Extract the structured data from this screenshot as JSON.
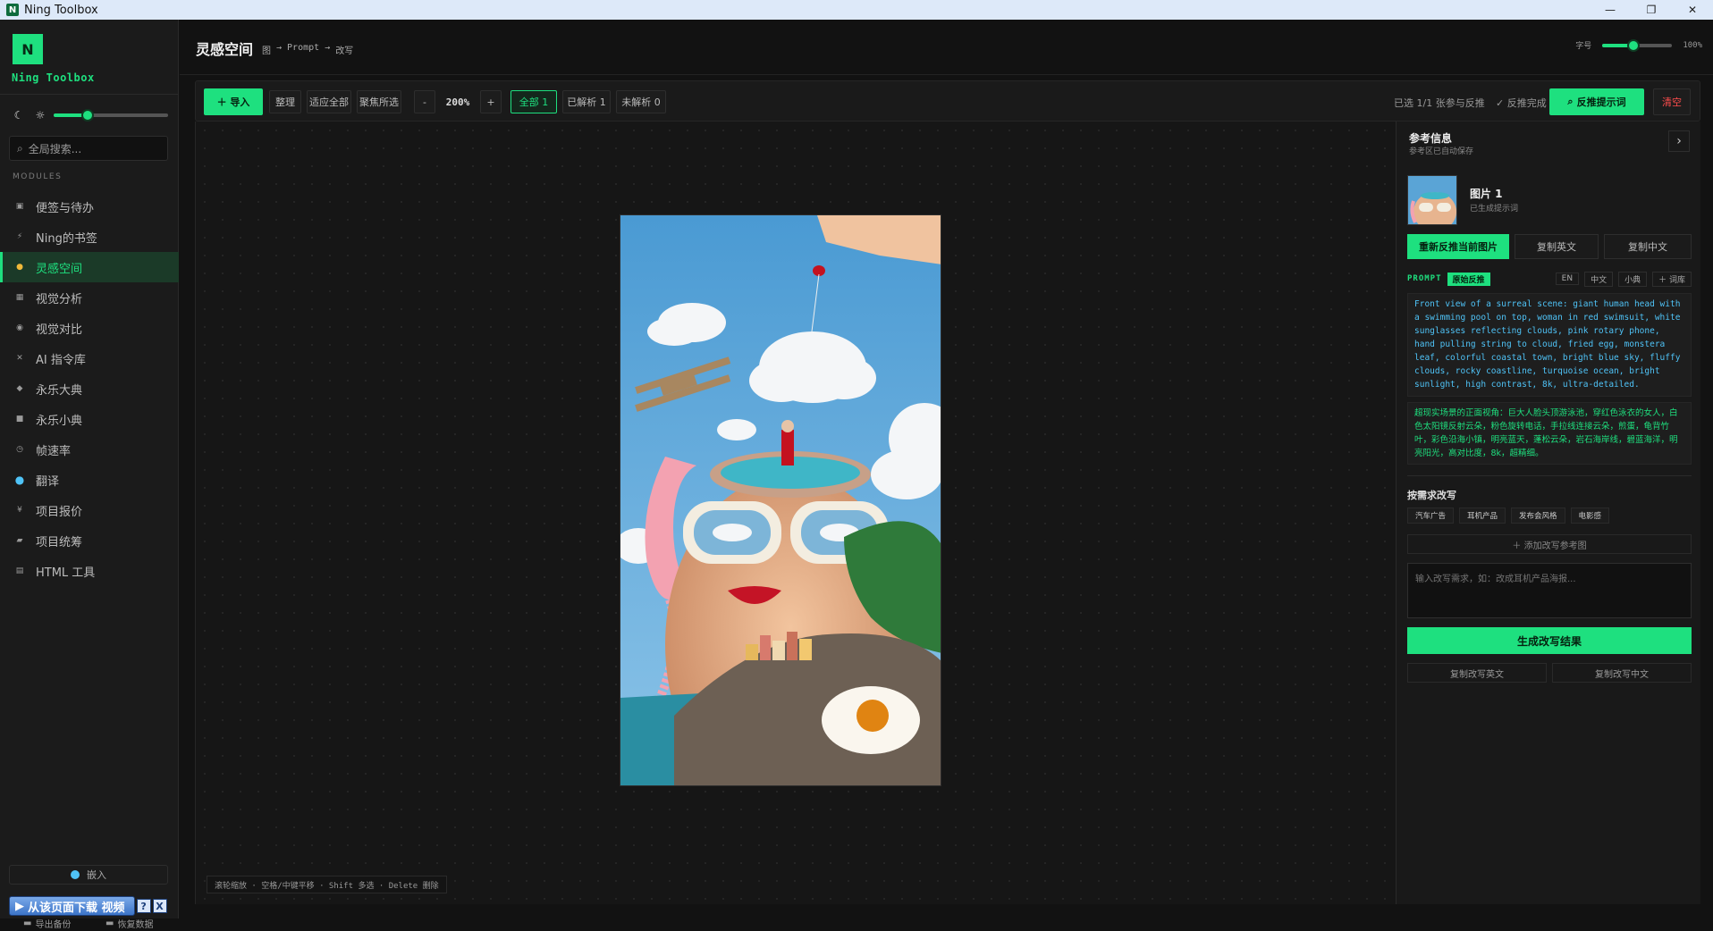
{
  "window": {
    "title": "Ning Toolbox",
    "controls": [
      "—",
      "❐",
      "✕"
    ]
  },
  "sidebar": {
    "logo_letter": "N",
    "brand": "Ning Toolbox",
    "search_placeholder": "全局搜索...",
    "modules_label": "MODULES",
    "brightness": 0.3,
    "items": [
      {
        "label": "便签与待办",
        "icon": "note-icon",
        "glyph": "▣"
      },
      {
        "label": "Ning的书签",
        "icon": "bolt-icon",
        "glyph": "⚡"
      },
      {
        "label": "灵感空间",
        "icon": "bulb-icon",
        "glyph": "●",
        "active": true
      },
      {
        "label": "视觉分析",
        "icon": "grid-icon",
        "glyph": "▦"
      },
      {
        "label": "视觉对比",
        "icon": "eye-icon",
        "glyph": "◉"
      },
      {
        "label": "AI 指令库",
        "icon": "cross-icon",
        "glyph": "✕"
      },
      {
        "label": "永乐大典",
        "icon": "diamond-icon",
        "glyph": "◆"
      },
      {
        "label": "永乐小典",
        "icon": "book-icon",
        "glyph": "■"
      },
      {
        "label": "帧速率",
        "icon": "timer-icon",
        "glyph": "◷"
      },
      {
        "label": "翻译",
        "icon": "globe-icon",
        "glyph": "●"
      },
      {
        "label": "项目报价",
        "icon": "yen-icon",
        "glyph": "¥"
      },
      {
        "label": "项目统筹",
        "icon": "folder-icon",
        "glyph": "▰"
      },
      {
        "label": "HTML 工具",
        "icon": "code-icon",
        "glyph": "▤"
      }
    ],
    "bottom_label": "嵌入",
    "export_label": "导出备份",
    "restore_label": "恢复数据",
    "download_label": "从该页面下载 视频",
    "download_help": "?",
    "download_close": "X"
  },
  "header": {
    "title": "灵感空间",
    "breadcrumb": [
      "图",
      "→",
      "Prompt",
      "→",
      "改写"
    ],
    "zoom_label": "字号",
    "zoom_value": "100%",
    "zoom_level": 0.45
  },
  "toolbar": {
    "import": "＋ 导入",
    "arrange": "整理",
    "fit_all": "适应全部",
    "focus_selected": "聚焦所选",
    "zoom_out": "-",
    "zoom_level": "200%",
    "zoom_in": "+",
    "filter_all": "全部 1",
    "filter_parsed": "已解析 1",
    "filter_unparsed": "未解析 0",
    "status": "已选 1/1 张参与反推",
    "done": "✓ 反推完成",
    "reverse_prompt": "反推提示词",
    "clear": "清空"
  },
  "canvas": {
    "hint": "滚轮缩放 · 空格/中键平移 · Shift 多选 · Delete 删除"
  },
  "panel": {
    "title": "参考信息",
    "subtitle": "参考区已自动保存",
    "collapse": "›",
    "image_title": "图片 1",
    "image_sub": "已生成提示词",
    "btn_reanalyze": "重新反推当前图片",
    "btn_copy_en": "复制英文",
    "btn_copy_zh": "复制中文",
    "prompt_label": "PROMPT",
    "prompt_tag": "原始反推",
    "lang_en": "EN",
    "lang_zh": "中文",
    "btn_small": "小典",
    "btn_lexicon": "＋ 词库",
    "prompt_en": "Front view of a surreal scene: giant human head with a swimming pool on top, woman in red swimsuit, white sunglasses reflecting clouds, pink rotary phone, hand pulling string to cloud, fried egg, monstera leaf, colorful coastal town, bright blue sky, fluffy clouds, rocky coastline, turquoise ocean, bright sunlight, high contrast, 8k, ultra-detailed.",
    "prompt_zh": "超现实场景的正面视角：巨大人脸头顶游泳池，穿红色泳衣的女人，白色太阳镜反射云朵，粉色旋转电话，手拉线连接云朵，煎蛋，龟背竹叶，彩色沿海小镇，明亮蓝天，蓬松云朵，岩石海岸线，碧蓝海洋，明亮阳光，高对比度，8k，超精细。",
    "rewrite_title": "按需求改写",
    "chips": [
      "汽车广告",
      "耳机产品",
      "发布会风格",
      "电影感"
    ],
    "add_ref": "＋ 添加改写参考图",
    "rewrite_placeholder": "输入改写需求，如：改成耳机产品海报...",
    "generate": "生成改写结果",
    "copy_rewrite_en": "复制改写英文",
    "copy_rewrite_zh": "复制改写中文"
  },
  "colors": {
    "accent": "#1ee07f",
    "bg": "#121212",
    "sidebar": "#1b1b1b",
    "prompt_en": "#4fc3f7",
    "danger": "#ff4d4d"
  }
}
